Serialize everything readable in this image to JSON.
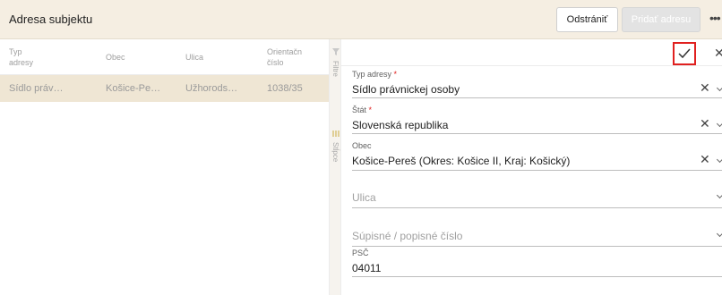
{
  "header": {
    "title": "Adresa subjektu",
    "remove_label": "Odstrániť",
    "add_label": "Pridať adresu"
  },
  "table": {
    "columns": [
      {
        "line1": "Typ",
        "line2": "adresy"
      },
      {
        "line1": "Obec",
        "line2": ""
      },
      {
        "line1": "Ulica",
        "line2": ""
      },
      {
        "line1": "Orientačn",
        "line2": "číslo"
      }
    ],
    "rows": [
      [
        "Sídlo práv…",
        "Košice-Pe…",
        "Užhorods…",
        "1038/35"
      ]
    ]
  },
  "side": {
    "filters_label": "Filtre",
    "columns_label": "Stĺpce"
  },
  "form": {
    "fields": {
      "address_type": {
        "label": "Typ adresy",
        "required": "*",
        "value": "Sídlo právnickej osoby"
      },
      "state": {
        "label": "Štát",
        "required": "*",
        "value": "Slovenská republika"
      },
      "municipality": {
        "label": "Obec",
        "value": "Košice-Pereš (Okres: Košice II, Kraj: Košický)"
      },
      "street": {
        "placeholder": "Ulica"
      },
      "number": {
        "placeholder": "Súpisné / popisné číslo"
      },
      "zip": {
        "label": "PSČ",
        "value": "04011"
      }
    }
  },
  "icons": {
    "confirm": "check-icon",
    "close": "close-icon",
    "more": "more-horizontal-icon",
    "clear": "clear-icon",
    "dropdown": "chevron-down-icon",
    "filter": "funnel-icon",
    "columns": "columns-icon"
  },
  "colors": {
    "header_bg": "#f5eee2",
    "selected_row_bg": "#efe6d4",
    "required": "#e0201f",
    "highlight_border": "#e0201f"
  }
}
